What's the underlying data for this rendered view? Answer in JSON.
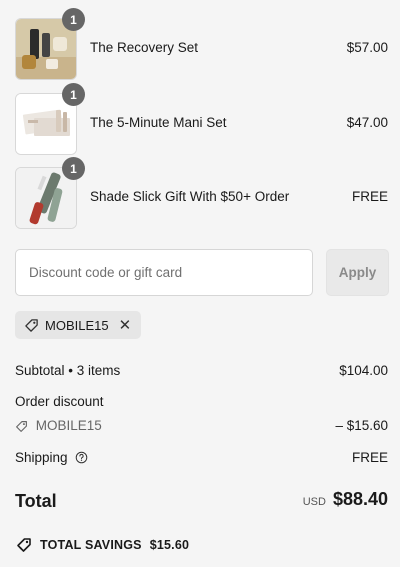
{
  "items": [
    {
      "name": "The Recovery Set",
      "price": "$57.00",
      "qty": "1",
      "thumb_icon": "product-thumbnail"
    },
    {
      "name": "The 5-Minute Mani Set",
      "price": "$47.00",
      "qty": "1",
      "thumb_icon": "product-thumbnail"
    },
    {
      "name": "Shade Slick Gift With $50+ Order",
      "price": "FREE",
      "qty": "1",
      "thumb_icon": "product-thumbnail"
    }
  ],
  "discount": {
    "placeholder": "Discount code or gift card",
    "value": "",
    "apply_label": "Apply",
    "applied_code": "MOBILE15"
  },
  "summary": {
    "subtotal_label": "Subtotal • 3 items",
    "subtotal_value": "$104.00",
    "order_discount_label": "Order discount",
    "discount_code": "MOBILE15",
    "discount_value": "– $15.60",
    "shipping_label": "Shipping",
    "shipping_value": "FREE",
    "total_label": "Total",
    "currency": "USD",
    "total_value": "$88.40",
    "savings_label": "TOTAL SAVINGS",
    "savings_value": "$15.60"
  },
  "colors": {
    "background": "#f5f5f5",
    "badge": "#666666",
    "chip": "#e6e6e6",
    "apply_button": "#e9e9e9"
  }
}
